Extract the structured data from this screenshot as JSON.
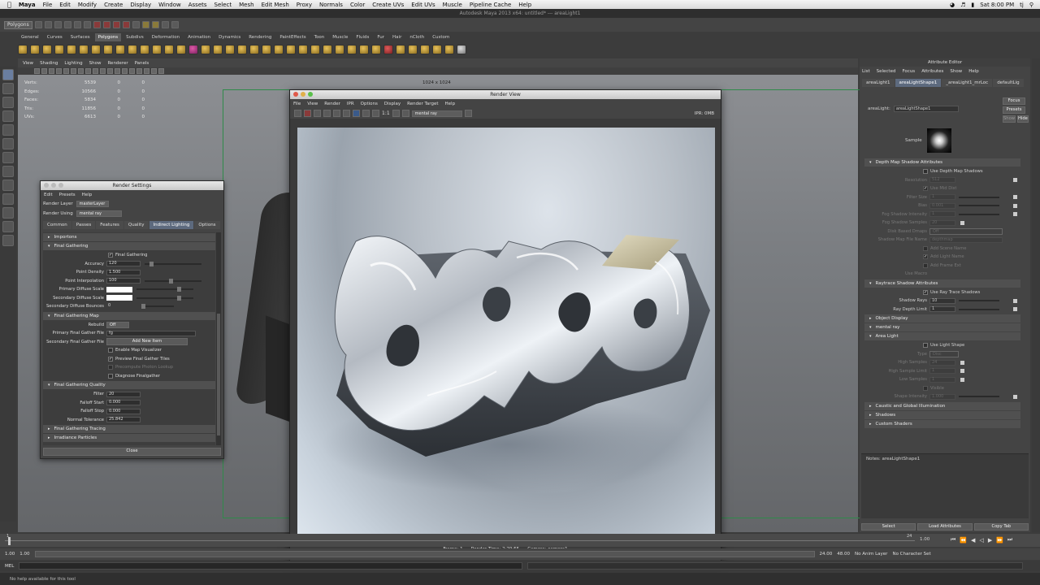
{
  "macbar": {
    "app": "Maya",
    "menus": [
      "File",
      "Edit",
      "Modify",
      "Create",
      "Display",
      "Window",
      "Assets",
      "Select",
      "Mesh",
      "Edit Mesh",
      "Proxy",
      "Normals",
      "Color",
      "Create UVs",
      "Edit UVs",
      "Muscle",
      "Pipeline Cache",
      "Help"
    ],
    "clock": "Sat 8:00 PM",
    "user": "tj"
  },
  "maya_title": "Autodesk Maya 2013 x64: untitled*  ---  areaLight1",
  "statusline": {
    "mode": "Polygons"
  },
  "shelf": {
    "tabs": [
      "General",
      "Curves",
      "Surfaces",
      "Polygons",
      "Subdivs",
      "Deformation",
      "Animation",
      "Dynamics",
      "Rendering",
      "PaintEffects",
      "Toon",
      "Muscle",
      "Fluids",
      "Fur",
      "Hair",
      "nCloth",
      "Custom"
    ],
    "active_tab": "Polygons"
  },
  "viewport": {
    "menu": [
      "View",
      "Shading",
      "Lighting",
      "Show",
      "Renderer",
      "Panels"
    ],
    "hud": [
      {
        "label": "Verts:",
        "a": "5539",
        "b": "0",
        "c": "0"
      },
      {
        "label": "Edges:",
        "a": "10566",
        "b": "0",
        "c": "0"
      },
      {
        "label": "Faces:",
        "a": "5834",
        "b": "0",
        "c": "0"
      },
      {
        "label": "Tris:",
        "a": "11856",
        "b": "0",
        "c": "0"
      },
      {
        "label": "UVs:",
        "a": "6613",
        "b": "0",
        "c": "0"
      }
    ],
    "resolution": "1024 x 1024"
  },
  "render_settings": {
    "title": "Render Settings",
    "menu": [
      "Edit",
      "Presets",
      "Help"
    ],
    "render_layer_label": "Render Layer",
    "render_layer_value": "masterLayer",
    "render_using_label": "Render Using",
    "render_using_value": "mental ray",
    "tabs": [
      "Common",
      "Passes",
      "Features",
      "Quality",
      "Indirect Lighting",
      "Options"
    ],
    "active_tab": "Indirect Lighting",
    "sections": {
      "importons": "Importons",
      "final_gathering": "Final Gathering",
      "final_gathering_map": "Final Gathering Map",
      "final_gathering_quality": "Final Gathering Quality",
      "final_gathering_tracing": "Final Gathering Tracing",
      "irradiance_particles": "Irradiance Particles"
    },
    "fg": {
      "enable_label": "Final Gathering",
      "accuracy_label": "Accuracy",
      "accuracy": "120",
      "point_density_label": "Point Density",
      "point_density": "1.500",
      "point_interp_label": "Point Interpolation",
      "point_interp": "100",
      "primary_scale_label": "Primary Diffuse Scale",
      "secondary_scale_label": "Secondary Diffuse Scale",
      "bounces_label": "Secondary Diffuse Bounces",
      "bounces": "0"
    },
    "fgmap": {
      "rebuild_label": "Rebuild",
      "rebuild": "Off",
      "primary_file_label": "Primary Final Gather File",
      "primary_file": "fg",
      "secondary_file_label": "Secondary Final Gather File",
      "add_new_item": "Add New Item",
      "enable_visualizer": "Enable Map Visualizer",
      "preview_tiles": "Preview Final Gather Tiles",
      "precompute": "Precompute Photon Lookup",
      "diagnose": "Diagnose Finalgather"
    },
    "fgquality": {
      "filter_label": "Filter",
      "filter": "20",
      "falloff_start_label": "Falloff Start",
      "falloff_start": "0.000",
      "falloff_stop_label": "Falloff Stop",
      "falloff_stop": "0.000",
      "normal_tol_label": "Normal Tolerance",
      "normal_tol": "25.842"
    },
    "close": "Close"
  },
  "render_view": {
    "title": "Render View",
    "menu": [
      "File",
      "View",
      "Render",
      "IPR",
      "Options",
      "Display",
      "Render Target",
      "Help"
    ],
    "ratio": "1:1",
    "renderer": "mental ray",
    "ipr": "IPR: 0MB",
    "status": {
      "frame": "Frame: 1",
      "time": "Render Time: 2:29:55",
      "camera": "Camera: camera1"
    }
  },
  "attribute_editor": {
    "title": "Attribute Editor",
    "menu": [
      "List",
      "Selected",
      "Focus",
      "Attributes",
      "Show",
      "Help"
    ],
    "tabs": [
      "areaLight1",
      "areaLightShape1",
      "_areaLight1_mrLoc",
      "defaultLig"
    ],
    "active_tab": "areaLightShape1",
    "node_label": "areaLight:",
    "node_value": "areaLightShape1",
    "focus_btn": "Focus",
    "presets_btn": "Presets",
    "show_btn": "Show",
    "hide_btn": "Hide",
    "sample_label": "Sample",
    "depth_map": {
      "section": "Depth Map Shadow Attributes",
      "use_depth": "Use Depth Map Shadows",
      "resolution": "Resolution",
      "resolution_val": "512",
      "use_mid": "Use Mid Dist",
      "filter_size": "Filter Size",
      "filter_val": "1",
      "bias": "Bias",
      "bias_val": "0.001",
      "fog_int": "Fog Shadow Intensity",
      "fog_int_val": "1",
      "fog_samp": "Fog Shadow Samples",
      "fog_samp_val": "20",
      "disk_based": "Disk Based Dmaps",
      "disk_val": "Off",
      "file_name": "Shadow Map File Name",
      "file_val": "depthmap",
      "add_scene": "Add Scene Name",
      "add_light": "Add Light Name",
      "add_frame": "Add Frame Ext",
      "use_macro": "Use Macro"
    },
    "raytrace": {
      "section": "Raytrace Shadow Attributes",
      "use_ray": "Use Ray Trace Shadows",
      "shadow_rays": "Shadow Rays",
      "shadow_rays_val": "10",
      "ray_depth": "Ray Depth Limit",
      "ray_depth_val": "1"
    },
    "sections": {
      "object_display": "Object Display",
      "mental_ray": "mental ray",
      "area_light": "Area Light",
      "caustic": "Caustic and Global Illumination",
      "shadows": "Shadows",
      "custom_shaders": "Custom Shaders"
    },
    "area": {
      "use_shape": "Use Light Shape",
      "type": "Type",
      "type_val": "Disc",
      "high_samples": "High Samples",
      "high_samples_val": "24",
      "high_sample_limit": "High Sample Limit",
      "high_sample_limit_val": "1",
      "low_samples": "Low Samples",
      "low_samples_val": "1",
      "visible": "Visible",
      "shape_int": "Shape Intensity",
      "shape_int_val": "1.000"
    },
    "notes": "Notes:  areaLightShape1",
    "buttons": [
      "Select",
      "Load Attributes",
      "Copy Tab"
    ]
  },
  "timeline": {
    "start": "1.00",
    "end": "24.00",
    "range_start": "1.00",
    "range_end": "1.00",
    "tick_start": "1",
    "tick_end": "24",
    "anim_end": "48.00",
    "current": "1.00",
    "anim_layer": "No Anim Layer",
    "char_set": "No Character Set"
  },
  "cmdline": {
    "mode": "MEL"
  },
  "helpline": "No help available for this tool"
}
